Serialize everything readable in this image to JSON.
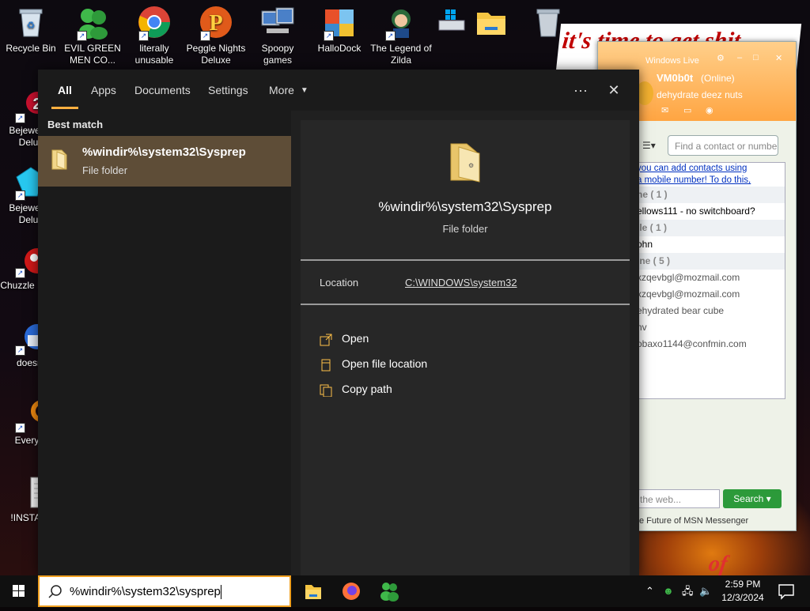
{
  "desktop": {
    "wallpaper_text": "it's time to get shit",
    "wallpaper_text_bottom": "of",
    "icons": [
      {
        "label": "Recycle Bin"
      },
      {
        "label": "EVIL GREEN MEN CO..."
      },
      {
        "label": "literally unusable"
      },
      {
        "label": "Peggle Nights Deluxe"
      },
      {
        "label": "Spoopy games"
      },
      {
        "label": "HalloDock"
      },
      {
        "label": "The Legend of Zilda"
      },
      {
        "label": "Bejeweled Delux"
      },
      {
        "label": "Bejeweled Delux"
      },
      {
        "label": "Chuzzle Delux"
      },
      {
        "label": "doesnt"
      },
      {
        "label": "Everyth"
      },
      {
        "label": "!INSTALL"
      }
    ]
  },
  "msn": {
    "title": "Windows Live",
    "username": "VM0b0t",
    "status": "(Online)",
    "personal_message": "dehydrate deez nuts",
    "find_placeholder": "Find a contact or numbe",
    "promo_line1": "you can add contacts using",
    "promo_line2": "a mobile number! To do this,",
    "groups": [
      {
        "header": "ne ( 1 )",
        "contacts": [
          "ellows111 - no switchboard?"
        ]
      },
      {
        "header": "ile ( 1 )",
        "contacts": [
          "ohn"
        ]
      },
      {
        "header": "ine ( 5 )",
        "contacts": [
          "xzqevbgl@mozmail.com",
          "xzqevbgl@mozmail.com",
          "ehydrated bear cube",
          "nv",
          "obaxo1144@confmin.com"
        ]
      }
    ],
    "web_search_placeholder": "the web...",
    "search_button": "Search",
    "footer": "e Future of MSN Messenger"
  },
  "search_panel": {
    "tabs": [
      {
        "label": "All",
        "active": true
      },
      {
        "label": "Apps"
      },
      {
        "label": "Documents"
      },
      {
        "label": "Settings"
      },
      {
        "label": "More"
      }
    ],
    "best_match_label": "Best match",
    "best_match": {
      "title": "%windir%\\system32\\Sysprep",
      "type": "File folder"
    },
    "detail": {
      "title": "%windir%\\system32\\Sysprep",
      "type": "File folder",
      "location_label": "Location",
      "location_value": "C:\\WINDOWS\\system32",
      "actions": [
        "Open",
        "Open file location",
        "Copy path"
      ]
    }
  },
  "taskbar": {
    "search_query": "%windir%\\system32\\sysprep",
    "time": "2:59 PM",
    "date": "12/3/2024"
  },
  "colors": {
    "accent": "#ffb040",
    "best_match_bg": "#5e4d37",
    "panel_bg": "#202020"
  }
}
